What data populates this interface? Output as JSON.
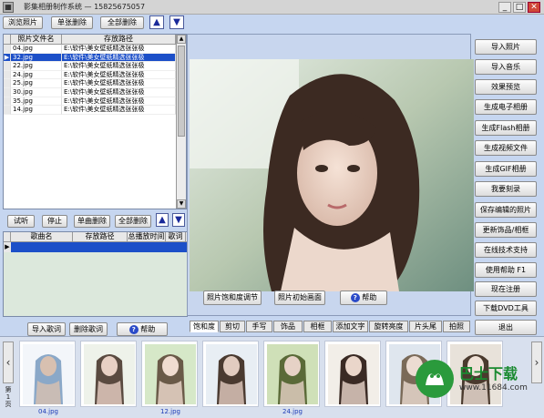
{
  "titlebar": {
    "title": "影集相册制作系统 — 15825675057",
    "icon": "app-icon",
    "minimize": "_",
    "maximize": "□",
    "close": "✕"
  },
  "photo_toolbar": {
    "browse": "浏览照片",
    "delete_one": "单张删除",
    "delete_all": "全部删除",
    "up_icon": "▲",
    "down_icon": "▼"
  },
  "photo_table": {
    "columns": [
      "照片文件名",
      "存放路径"
    ],
    "rows": [
      {
        "name": "04.jpg",
        "path": "E:\\软件\\美女壁纸精选张张极"
      },
      {
        "name": "32.jpg",
        "path": "E:\\软件\\美女壁纸精选张张极",
        "selected": true
      },
      {
        "name": "22.jpg",
        "path": "E:\\软件\\美女壁纸精选张张极"
      },
      {
        "name": "24.jpg",
        "path": "E:\\软件\\美女壁纸精选张张极"
      },
      {
        "name": "25.jpg",
        "path": "E:\\软件\\美女壁纸精选张张极"
      },
      {
        "name": "30.jpg",
        "path": "E:\\软件\\美女壁纸精选张张极"
      },
      {
        "name": "35.jpg",
        "path": "E:\\软件\\美女壁纸精选张张极"
      },
      {
        "name": "14.jpg",
        "path": "E:\\软件\\美女壁纸精选张张极"
      }
    ]
  },
  "music_toolbar": {
    "listen": "试听",
    "stop": "停止",
    "delete_one": "单曲删除",
    "delete_all": "全部删除",
    "up_icon": "▲",
    "down_icon": "▼"
  },
  "music_table": {
    "columns": [
      "歌曲名",
      "存放路径",
      "总播放时间",
      "歌词"
    ]
  },
  "lyrics_toolbar": {
    "import": "导入歌词",
    "delete": "删除歌词",
    "help": "帮助",
    "help_icon": "?"
  },
  "preview_controls": {
    "saturation": "照片饱和度调节",
    "init": "照片初始画面",
    "help": "帮助",
    "help_icon": "?"
  },
  "right_buttons": [
    "导入照片",
    "导入音乐",
    "效果预览",
    "生成电子相册",
    "生成Flash相册",
    "生成视频文件",
    "生成GIF相册",
    "我要刻录",
    "保存编辑的照片",
    "更新饰品/相框",
    "在线技术支持",
    "使用帮助  F1",
    "现在注册",
    "下载DVD工具",
    "退出"
  ],
  "tabs": [
    "饱和度",
    "剪切",
    "手写",
    "饰品",
    "相框",
    "添加文字",
    "旋转亮度",
    "片头尾",
    "拍照"
  ],
  "thumbnails": {
    "captions": [
      "04.jpg",
      "",
      "12.jpg",
      "",
      "24.jpg",
      "",
      "",
      ""
    ],
    "left_arrow": "‹",
    "right_arrow": "›",
    "page_label": "第 1 页"
  },
  "watermark": {
    "brand": "巴士下载",
    "url": "www.11684.com"
  },
  "colors": {
    "background": "#c6d6f0",
    "selection": "#1c4fc8",
    "nav_arrow": "#1a2a9a"
  }
}
